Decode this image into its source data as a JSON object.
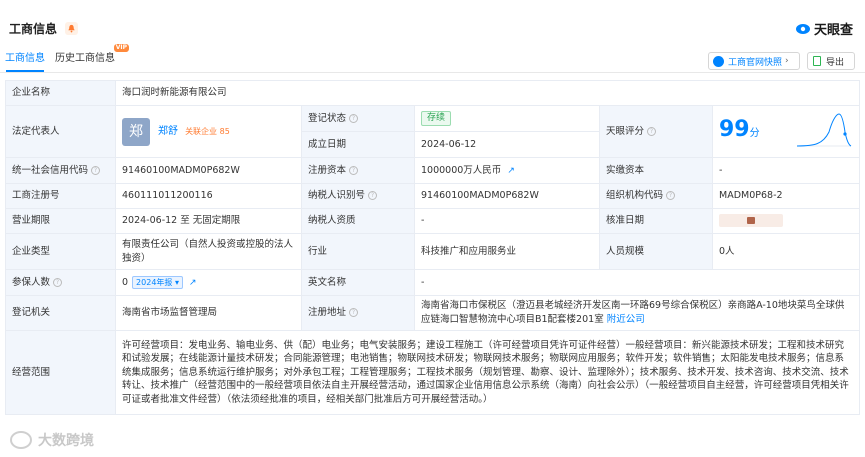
{
  "header": {
    "title": "工商信息",
    "brand": "天眼查"
  },
  "tabs": [
    {
      "label": "工商信息"
    },
    {
      "label": "历史工商信息"
    }
  ],
  "vip_badge": "VIP",
  "buttons": {
    "official_snapshot": "工商官网快照",
    "export": "导出"
  },
  "rows": {
    "company_name": {
      "label": "企业名称",
      "value": "海口润时新能源有限公司"
    },
    "legal_rep": {
      "label": "法定代表人",
      "avatar": "郑",
      "name": "郑舒",
      "related": "关联企业 85"
    },
    "reg_status": {
      "label": "登记状态",
      "value": "存续"
    },
    "founded": {
      "label": "成立日期",
      "value": "2024-06-12"
    },
    "tianyan_score": {
      "label": "天眼评分",
      "value": "99",
      "unit": "分"
    },
    "credit_code": {
      "label": "统一社会信用代码",
      "value": "91460100MADM0P682W"
    },
    "reg_capital": {
      "label": "注册资本",
      "value": "1000000万人民币"
    },
    "paid_capital": {
      "label": "实缴资本",
      "value": "-"
    },
    "reg_number": {
      "label": "工商注册号",
      "value": "460111011200116"
    },
    "taxpayer_id": {
      "label": "纳税人识别号",
      "value": "91460100MADM0P682W"
    },
    "org_code": {
      "label": "组织机构代码",
      "value": "MADM0P68-2"
    },
    "business_term": {
      "label": "营业期限",
      "value": "2024-06-12 至 无固定期限"
    },
    "taxpayer_quality": {
      "label": "纳税人资质",
      "value": "-"
    },
    "approval_date": {
      "label": "核准日期"
    },
    "company_type": {
      "label": "企业类型",
      "value": "有限责任公司（自然人投资或控股的法人独资）"
    },
    "industry": {
      "label": "行业",
      "value": "科技推广和应用服务业"
    },
    "staff_size": {
      "label": "人员规模",
      "value": "0人"
    },
    "insured": {
      "label": "参保人数",
      "value": "0",
      "year_badge": "2024年报"
    },
    "english_name": {
      "label": "英文名称",
      "value": "-"
    },
    "authority": {
      "label": "登记机关",
      "value": "海南省市场监督管理局"
    },
    "address": {
      "label": "注册地址",
      "value": "海南省海口市保税区（澄迈县老城经济开发区南一环路69号综合保税区）亲商路A-10地块菜鸟全球供应链海口智慧物流中心项目B1配套楼201室",
      "link": "附近公司"
    },
    "scope": {
      "label": "经营范围",
      "value": "许可经营项目：发电业务、输电业务、供（配）电业务；电气安装服务；建设工程施工（许可经营项目凭许可证件经营）一般经营项目：新兴能源技术研发；工程和技术研究和试验发展；在线能源计量技术研发；合同能源管理；电池销售；物联网技术研发；物联网技术服务；物联网应用服务；软件开发；软件销售；太阳能发电技术服务；信息系统集成服务；信息系统运行维护服务；对外承包工程；工程管理服务；工程技术服务（规划管理、勘察、设计、监理除外）；技术服务、技术开发、技术咨询、技术交流、技术转让、技术推广（经营范围中的一般经营项目依法自主开展经营活动，通过国家企业信用信息公示系统（海南）向社会公示）（一般经营项目自主经营，许可经营项目凭相关许可证或者批准文件经营）（依法须经批准的项目，经相关部门批准后方可开展经营活动。）"
    }
  },
  "watermark": "大数跨境"
}
